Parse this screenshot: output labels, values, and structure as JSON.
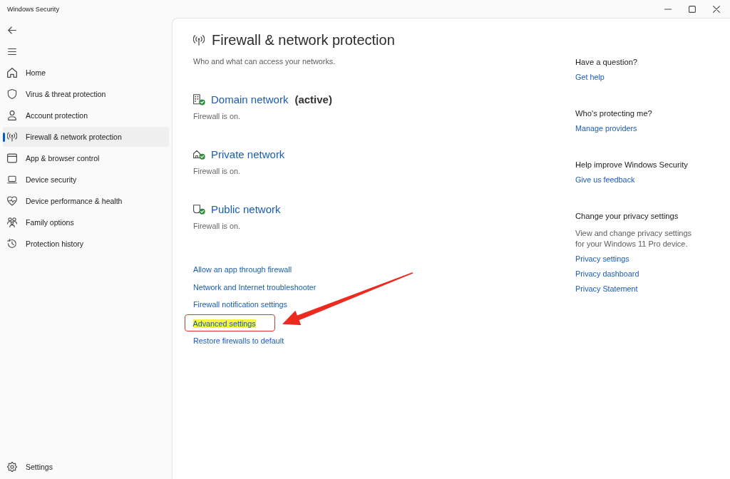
{
  "window": {
    "title": "Windows Security"
  },
  "sidebar": {
    "items": [
      {
        "kind": "home",
        "label": "Home",
        "selected": false
      },
      {
        "kind": "virus",
        "label": "Virus & threat protection",
        "selected": false
      },
      {
        "kind": "account",
        "label": "Account protection",
        "selected": false
      },
      {
        "kind": "firewall",
        "label": "Firewall & network protection",
        "selected": true
      },
      {
        "kind": "app",
        "label": "App & browser control",
        "selected": false
      },
      {
        "kind": "device",
        "label": "Device security",
        "selected": false
      },
      {
        "kind": "performance",
        "label": "Device performance & health",
        "selected": false
      },
      {
        "kind": "family",
        "label": "Family options",
        "selected": false
      },
      {
        "kind": "history",
        "label": "Protection history",
        "selected": false
      }
    ],
    "footer_items": [
      {
        "kind": "settings",
        "label": "Settings",
        "selected": false
      }
    ]
  },
  "page": {
    "title": "Firewall & network protection",
    "subtitle": "Who and what can access your networks.",
    "networks": [
      {
        "kind": "domain",
        "name": "Domain network",
        "badge": "(active)",
        "status": "Firewall is on."
      },
      {
        "kind": "private",
        "name": "Private network",
        "status": "Firewall is on."
      },
      {
        "kind": "public",
        "name": "Public network",
        "status": "Firewall is on."
      }
    ],
    "links": [
      {
        "label": "Allow an app through firewall",
        "highlighted": false,
        "callout": false
      },
      {
        "label": "Network and Internet troubleshooter",
        "highlighted": false,
        "callout": false
      },
      {
        "label": "Firewall notification settings",
        "highlighted": false,
        "callout": false
      },
      {
        "label": "Advanced settings",
        "highlighted": true,
        "callout": true
      },
      {
        "label": "Restore firewalls to default",
        "highlighted": false,
        "callout": false
      }
    ]
  },
  "side_panel": {
    "sections": [
      {
        "heading": "Have a question?",
        "links": [
          "Get help"
        ]
      },
      {
        "heading": "Who's protecting me?",
        "links": [
          "Manage providers"
        ]
      },
      {
        "heading": "Help improve Windows Security",
        "links": [
          "Give us feedback"
        ]
      },
      {
        "heading": "Change your privacy settings",
        "description": "View and change privacy settings for your Windows 11 Pro device.",
        "links": [
          "Privacy settings",
          "Privacy dashboard",
          "Privacy Statement"
        ]
      }
    ]
  }
}
